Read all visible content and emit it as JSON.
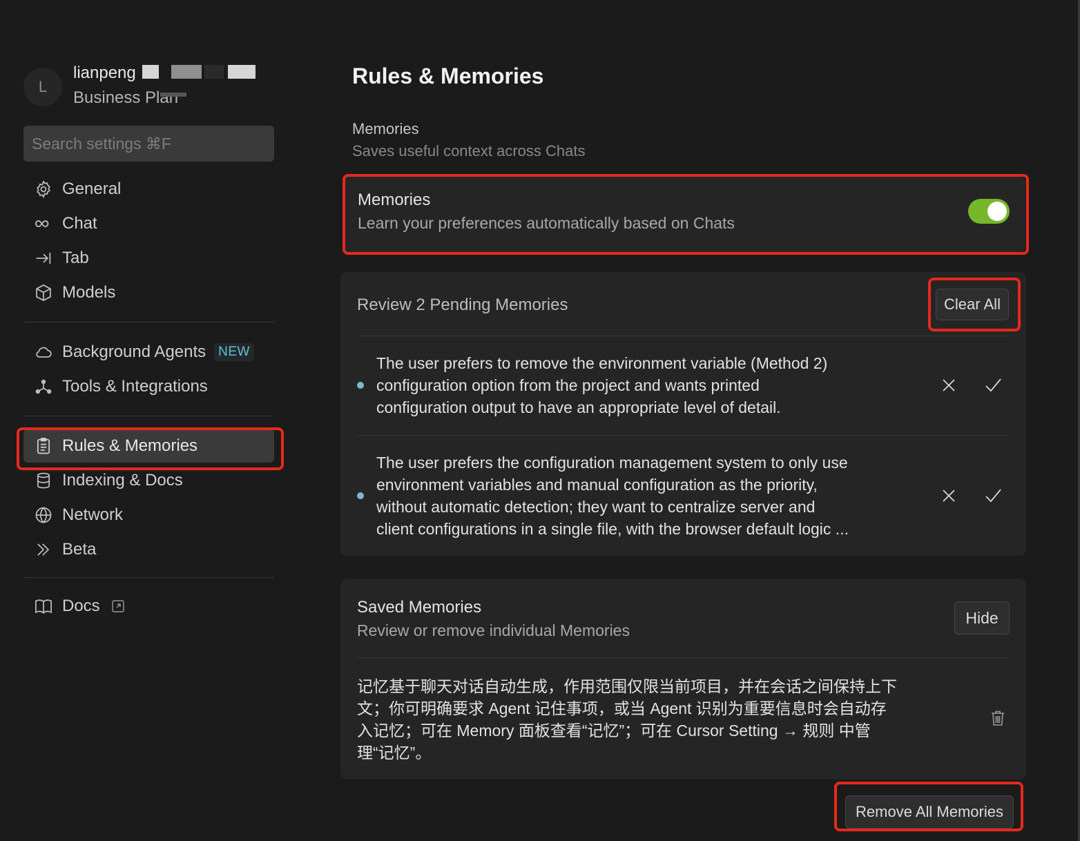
{
  "profile": {
    "initial": "L",
    "name": "lianpeng",
    "plan": "Business Plan"
  },
  "search": {
    "placeholder": "Search settings ⌘F"
  },
  "nav": {
    "general": "General",
    "chat": "Chat",
    "tab": "Tab",
    "models": "Models",
    "background_agents": "Background Agents",
    "new_badge": "NEW",
    "tools": "Tools & Integrations",
    "rules": "Rules & Memories",
    "indexing": "Indexing & Docs",
    "network": "Network",
    "beta": "Beta",
    "docs": "Docs"
  },
  "main": {
    "title": "Rules & Memories",
    "section_title": "Memories",
    "section_sub": "Saves useful context across Chats",
    "memories_toggle": {
      "title": "Memories",
      "subtitle": "Learn your preferences automatically based on Chats",
      "enabled": true
    },
    "pending": {
      "title": "Review 2 Pending Memories",
      "clear_all": "Clear All",
      "items": [
        {
          "line1": "The user prefers to remove the environment variable (Method 2)",
          "line2": "configuration option from the project and wants printed",
          "line3": "configuration output to have an appropriate level of detail."
        },
        {
          "line1": "The user prefers the configuration management system to only use",
          "line2": "environment variables and manual configuration as the priority,",
          "line3": "without automatic detection; they want to centralize server and",
          "line4": "client configurations in a single file, with the browser default logic ..."
        }
      ]
    },
    "saved": {
      "title": "Saved Memories",
      "subtitle": "Review or remove individual Memories",
      "hide": "Hide",
      "item": {
        "line1": "记忆基于聊天对话自动生成，作用范围仅限当前项目，并在会话之间保持上下",
        "line2": "文；你可明确要求 Agent 记住事项，或当 Agent 识别为重要信息时会自动存",
        "line3": "入记忆；可在 Memory 面板查看“记忆”；可在 Cursor Setting → 规则 中管",
        "line4": "理“记忆”。"
      }
    },
    "remove_all": "Remove All Memories"
  },
  "colors": {
    "background": "#1b1b1b",
    "card": "#252525",
    "toggle_on": "#76b82a",
    "highlight": "#e5291c",
    "pending_dot": "#7cb8d1",
    "new_badge": "#5fc1d8"
  }
}
